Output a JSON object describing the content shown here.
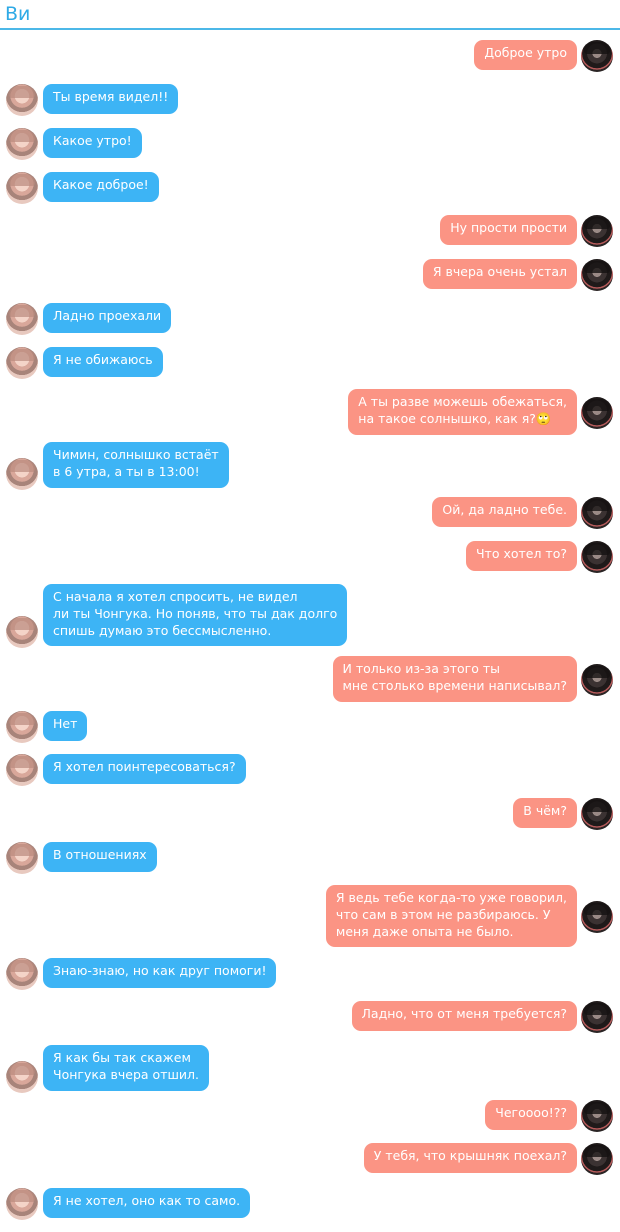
{
  "header": {
    "title": "Ви"
  },
  "colors": {
    "incoming": "#3db4f5",
    "outgoing": "#fb9484",
    "accent": "#4cb8e8"
  },
  "messages": [
    {
      "side": "out",
      "text": "Доброе утро"
    },
    {
      "side": "in",
      "text": "Ты время видел!!"
    },
    {
      "side": "in",
      "text": "Какое утро!"
    },
    {
      "side": "in",
      "text": "Какое доброе!"
    },
    {
      "side": "out",
      "text": "Ну прости прости"
    },
    {
      "side": "out",
      "text": "Я вчера очень устал"
    },
    {
      "side": "in",
      "text": "Ладно проехали"
    },
    {
      "side": "in",
      "text": "Я не обижаюсь"
    },
    {
      "side": "out",
      "text": "А ты разве можешь обежаться,\nна такое солнышко, как я?🙄"
    },
    {
      "side": "in",
      "text": "Чимин, солнышко встаёт\nв 6 утра, а ты в 13:00!"
    },
    {
      "side": "out",
      "text": "Ой, да ладно тебе."
    },
    {
      "side": "out",
      "text": "Что хотел то?"
    },
    {
      "side": "in",
      "text": "С начала я хотел спросить, не видел\nли ты Чонгука. Но поняв, что ты дак долго\nспишь думаю это бессмысленно."
    },
    {
      "side": "out",
      "text": "И только из-за этого ты\nмне столько времени написывал?"
    },
    {
      "side": "in",
      "text": "Нет"
    },
    {
      "side": "in",
      "text": "Я хотел поинтересоваться?"
    },
    {
      "side": "out",
      "text": "В чём?"
    },
    {
      "side": "in",
      "text": "В отношениях"
    },
    {
      "side": "out",
      "text": "Я ведь тебе когда-то уже говорил,\nчто сам в этом не разбираюсь. У\nменя даже опыта не было."
    },
    {
      "side": "in",
      "text": "Знаю-знаю, но как друг помоги!"
    },
    {
      "side": "out",
      "text": "Ладно, что от меня требуется?"
    },
    {
      "side": "in",
      "text": "Я как бы так скажем\nЧонгука вчера отшил."
    },
    {
      "side": "out",
      "text": "Чегоооо!??"
    },
    {
      "side": "out",
      "text": "У тебя, что крышняк поехал?"
    },
    {
      "side": "in",
      "text": "Я не хотел, оно как то само."
    }
  ]
}
